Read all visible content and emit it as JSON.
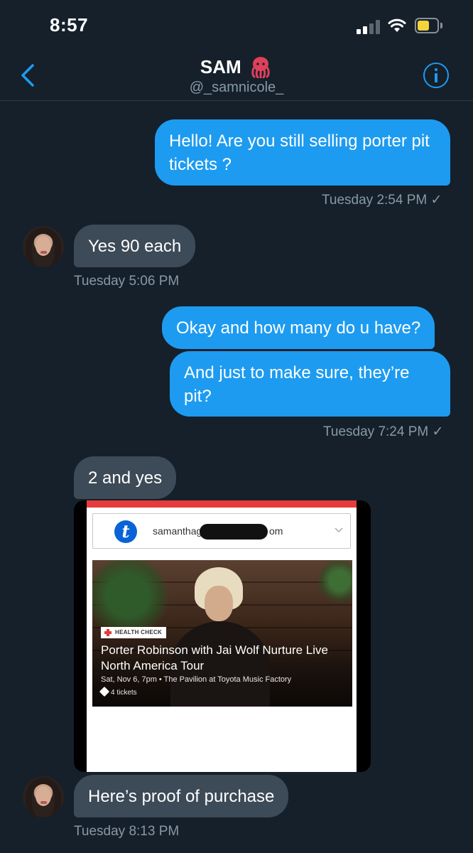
{
  "status_bar": {
    "time": "8:57"
  },
  "header": {
    "name": "SAM",
    "emoji_icon": "octopus-icon",
    "handle": "@_samnicole_"
  },
  "messages": [
    {
      "side": "sent",
      "text": "Hello! Are you still selling porter pit tickets ?"
    },
    {
      "side": "received",
      "text": "Yes 90 each"
    },
    {
      "side": "sent",
      "text": "Okay and how many do u have?"
    },
    {
      "side": "sent",
      "text": "And just to make sure, they’re pit?"
    },
    {
      "side": "received",
      "text": "2 and yes"
    },
    {
      "side": "received",
      "text": "Here’s proof of purchase"
    }
  ],
  "timestamps": [
    "Tuesday 2:54 PM ✓",
    "Tuesday 5:06 PM",
    "Tuesday 7:24 PM ✓",
    "Tuesday 8:13 PM"
  ],
  "attachment": {
    "logo_letter": "t",
    "email_prefix": "samanthag",
    "email_suffix": "om",
    "badge": "HEALTH CHECK",
    "event_title": "Porter Robinson with Jai Wolf Nurture Live North America Tour",
    "event_details": "Sat, Nov 6, 7pm • The Pavilion at Toyota Music Factory",
    "tickets": "4 tickets"
  },
  "colors": {
    "background": "#15202b",
    "sent_bubble": "#1d9bf0",
    "received_bubble": "#3d4a57",
    "secondary_text": "#8899a6"
  }
}
